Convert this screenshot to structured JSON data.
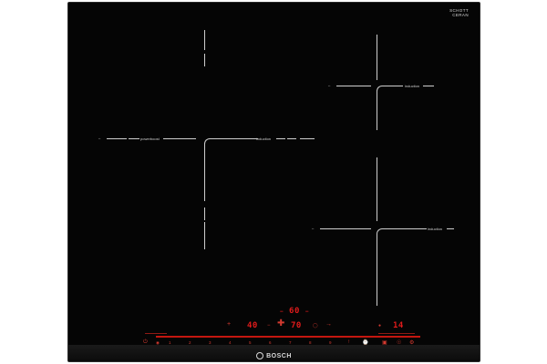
{
  "brand": "BOSCH",
  "glass_brand": [
    "SCHOTT",
    "CERAN"
  ],
  "zones": {
    "left_outer_label": "↔",
    "left_powerboost": "powerboost",
    "left_induction": "induction",
    "right_top_outer": "↔",
    "right_top_induction": "induction",
    "right_bottom_outer": "↔",
    "right_bottom_induction": "induction"
  },
  "display": {
    "timer_top": "60",
    "power_left": "40",
    "power_center": "70",
    "power_right": "14"
  },
  "slider": {
    "numbers": [
      "1",
      "2",
      "3",
      "4",
      "5",
      "6",
      "7",
      "8",
      "9"
    ]
  }
}
